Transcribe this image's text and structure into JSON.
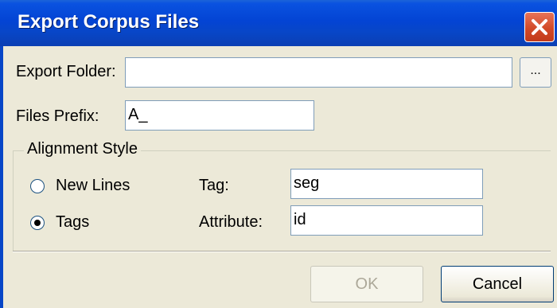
{
  "window": {
    "title": "Export Corpus Files"
  },
  "export_folder": {
    "label": "Export Folder:",
    "value": "",
    "browse_label": "..."
  },
  "files_prefix": {
    "label": "Files Prefix:",
    "value": "A_"
  },
  "alignment": {
    "group_title": "Alignment Style",
    "options": [
      {
        "label": "New Lines",
        "selected": false
      },
      {
        "label": "Tags",
        "selected": true
      }
    ],
    "tag": {
      "label": "Tag:",
      "value": "seg"
    },
    "attribute": {
      "label": "Attribute:",
      "value": "id"
    }
  },
  "buttons": {
    "ok": "OK",
    "cancel": "Cancel"
  },
  "colors": {
    "titlebar": "#0344d4",
    "close": "#d24a28",
    "dialog_bg": "#ece9d8"
  }
}
